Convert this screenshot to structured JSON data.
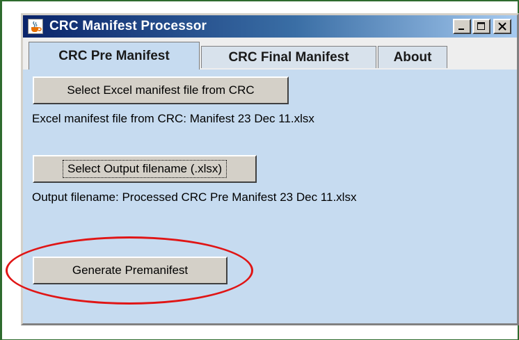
{
  "window": {
    "title": "CRC Manifest Processor",
    "controls": {
      "minimize": "_",
      "maximize": "□",
      "close": "×"
    }
  },
  "tabs": [
    {
      "label": "CRC Pre Manifest",
      "active": true
    },
    {
      "label": "CRC Final Manifest",
      "active": false
    },
    {
      "label": "About",
      "active": false
    }
  ],
  "panel": {
    "select_excel_button": "Select Excel manifest file from CRC",
    "excel_file_label": "Excel manifest file from CRC:  Manifest 23 Dec 11.xlsx",
    "select_output_button": "Select Output filename (.xlsx)",
    "output_file_label": "Output filename:  Processed CRC Pre Manifest 23 Dec 11.xlsx",
    "generate_button": "Generate Premanifest"
  },
  "colors": {
    "panel_bg": "#c6dbf0",
    "titlebar_start": "#0a246a",
    "titlebar_end": "#a6caf0",
    "annotation": "#e01515",
    "frame": "#2e6b2e"
  },
  "icons": {
    "app": "java-coffee-cup-icon"
  }
}
